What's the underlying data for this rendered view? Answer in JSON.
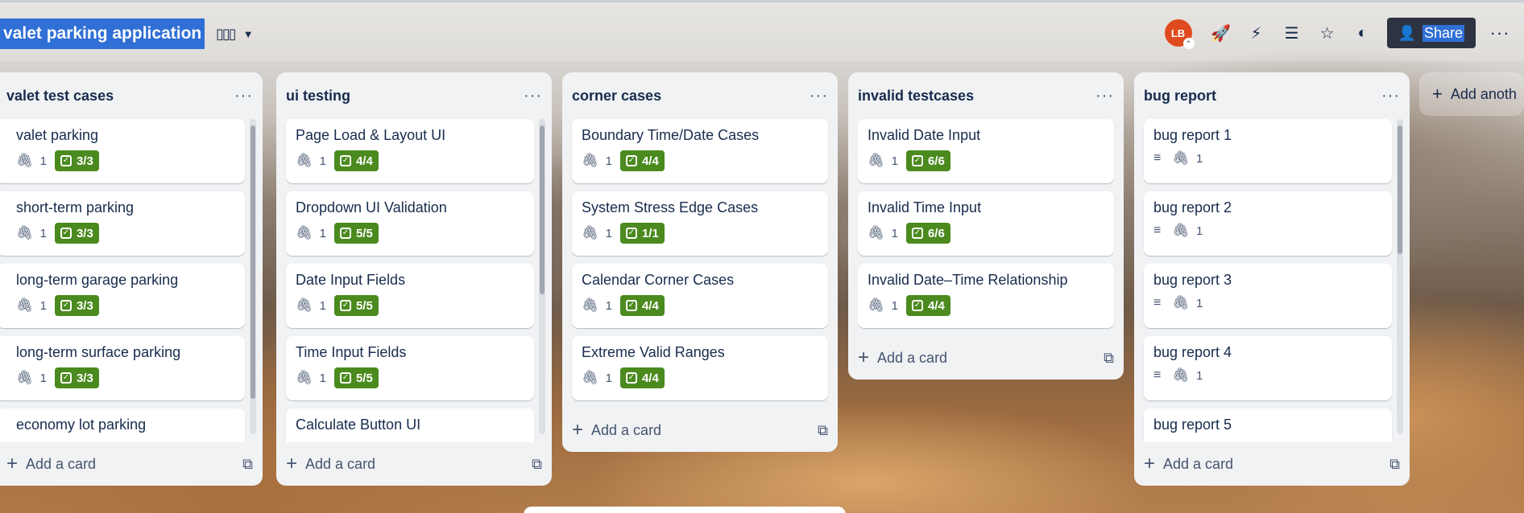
{
  "board": {
    "title": "valet parking application",
    "view_icon": "board-icon",
    "view_chevron": "⌄"
  },
  "header_actions": {
    "avatar_initials": "LB",
    "share_label": "Share",
    "more": "···"
  },
  "lists": [
    {
      "title": "valet test cases",
      "cards": [
        {
          "title": "valet parking",
          "attachments": "1",
          "checklist": "3/3"
        },
        {
          "title": "short-term parking",
          "attachments": "1",
          "checklist": "3/3"
        },
        {
          "title": "long-term garage parking",
          "attachments": "1",
          "checklist": "3/3"
        },
        {
          "title": "long-term surface parking",
          "attachments": "1",
          "checklist": "3/3"
        },
        {
          "title": "economy lot parking",
          "attachments": "",
          "checklist": ""
        }
      ]
    },
    {
      "title": "ui testing",
      "cards": [
        {
          "title": "Page Load & Layout UI",
          "attachments": "1",
          "checklist": "4/4"
        },
        {
          "title": "Dropdown UI Validation",
          "attachments": "1",
          "checklist": "5/5"
        },
        {
          "title": "Date Input Fields",
          "attachments": "1",
          "checklist": "5/5"
        },
        {
          "title": "Time Input Fields",
          "attachments": "1",
          "checklist": "5/5"
        },
        {
          "title": "Calculate Button UI",
          "attachments": "",
          "checklist": ""
        }
      ]
    },
    {
      "title": "corner cases",
      "cards": [
        {
          "title": "Boundary Time/Date Cases",
          "attachments": "1",
          "checklist": "4/4"
        },
        {
          "title": "System Stress Edge Cases",
          "attachments": "1",
          "checklist": "1/1"
        },
        {
          "title": "Calendar Corner Cases",
          "attachments": "1",
          "checklist": "4/4"
        },
        {
          "title": "Extreme Valid Ranges",
          "attachments": "1",
          "checklist": "4/4"
        }
      ]
    },
    {
      "title": "invalid testcases",
      "cards": [
        {
          "title": "Invalid Date Input",
          "attachments": "1",
          "checklist": "6/6"
        },
        {
          "title": "Invalid Time Input",
          "attachments": "1",
          "checklist": "6/6"
        },
        {
          "title": "Invalid Date–Time Relationship",
          "attachments": "1",
          "checklist": "4/4"
        }
      ]
    },
    {
      "title": "bug report",
      "cards": [
        {
          "title": "bug report 1",
          "attachments": "1",
          "description": true
        },
        {
          "title": "bug report 2",
          "attachments": "1",
          "description": true
        },
        {
          "title": "bug report 3",
          "attachments": "1",
          "description": true
        },
        {
          "title": "bug report 4",
          "attachments": "1",
          "description": true
        },
        {
          "title": "bug report 5",
          "attachments": "",
          "description": false
        }
      ]
    }
  ],
  "add_card_label": "Add a card",
  "add_list_label": "Add anoth",
  "colors": {
    "checklist_complete": "#4b8a1e",
    "title_highlight": "#2f6fd6",
    "avatar": "#e04a1f"
  }
}
